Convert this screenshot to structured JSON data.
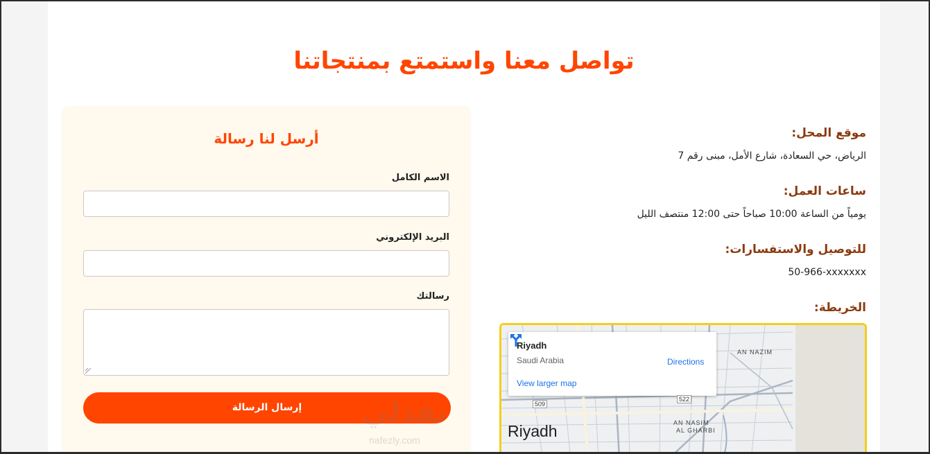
{
  "page": {
    "title": "تواصل معنا واستمتع بمنتجاتنا"
  },
  "form": {
    "title": "أرسل لنا رسالة",
    "name_label": "الاسم الكامل",
    "email_label": "البريد الإلكتروني",
    "message_label": "رسالتك",
    "submit_label": "إرسال الرسالة"
  },
  "info": {
    "location_heading": "موقع المحل:",
    "location_text": "الرياض، حي السعادة، شارع الأمل، مبنى رقم 7",
    "hours_heading": "ساعات العمل:",
    "hours_text": "يومياً من الساعة 10:00 صباحاً حتى 12:00 منتصف الليل",
    "contact_heading": "للتوصيل والاستفسارات:",
    "contact_text": "50-966-xxxxxxx",
    "map_heading": "الخريطة:"
  },
  "map": {
    "place": "Riyadh",
    "country": "Saudi Arabia",
    "directions": "Directions",
    "larger_map": "View larger map",
    "city_label": "Riyadh",
    "district_1": "AN NAZIM",
    "district_2": "AN NASIM",
    "district_3": "AL GHARBI",
    "route_1": "509",
    "route_2": "522"
  },
  "colors": {
    "accent": "#ff4500",
    "heading": "#8b3a0f",
    "map_border": "#f4cf1a"
  },
  "watermark": {
    "logo": "نفذلي",
    "url": "nafezly.com"
  }
}
